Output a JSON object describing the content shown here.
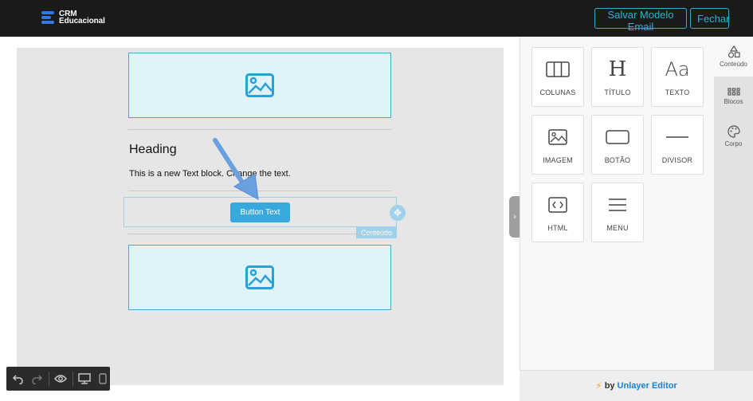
{
  "header": {
    "logo_line1": "CRM",
    "logo_line2": "Educacional",
    "save_label": "Salvar Modelo Email",
    "close_label": "Fechar"
  },
  "canvas": {
    "heading": "Heading",
    "paragraph": "This is a new Text block. Change the text.",
    "button_text": "Button Text",
    "selected_tag": "Conteúdo"
  },
  "tools": [
    "undo-icon",
    "redo-icon",
    "eye-icon",
    "desktop-icon",
    "mobile-icon"
  ],
  "panel": {
    "tiles": [
      {
        "label": "COLUNAS",
        "icon": "columns-icon"
      },
      {
        "label": "TÍTULO",
        "icon": "heading-icon"
      },
      {
        "label": "TEXTO",
        "icon": "text-icon"
      },
      {
        "label": "IMAGEM",
        "icon": "image-icon"
      },
      {
        "label": "BOTÃO",
        "icon": "button-icon"
      },
      {
        "label": "DIVISOR",
        "icon": "divider-icon"
      },
      {
        "label": "HTML",
        "icon": "html-icon"
      },
      {
        "label": "MENU",
        "icon": "menu-icon"
      }
    ],
    "footer_by": "by",
    "footer_brand": "Unlayer Editor"
  },
  "sidetabs": [
    {
      "label": "Conteúdo",
      "icon": "shapes-icon",
      "active": true
    },
    {
      "label": "Blocos",
      "icon": "grid-icon",
      "active": false
    },
    {
      "label": "Corpo",
      "icon": "palette-icon",
      "active": false
    }
  ],
  "colors": {
    "accent": "#26b3d1",
    "button": "#38a9dc",
    "topbar": "#1a1a1a",
    "brand": "#1e7fd6"
  }
}
